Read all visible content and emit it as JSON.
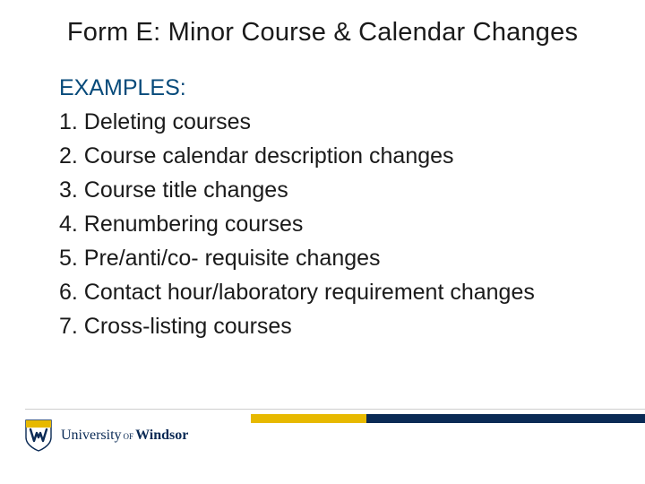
{
  "title": "Form E: Minor Course & Calendar Changes",
  "examples_label": "EXAMPLES:",
  "items": [
    "1. Deleting courses",
    "2. Course calendar description changes",
    "3. Course title changes",
    "4. Renumbering courses",
    "5. Pre/anti/co- requisite changes",
    "6. Contact hour/laboratory requirement changes",
    "7. Cross-listing courses"
  ],
  "brand": {
    "word_university": "University",
    "word_of": "OF",
    "word_windsor": "Windsor",
    "colors": {
      "navy": "#0a2a55",
      "gold": "#e7b900"
    }
  }
}
